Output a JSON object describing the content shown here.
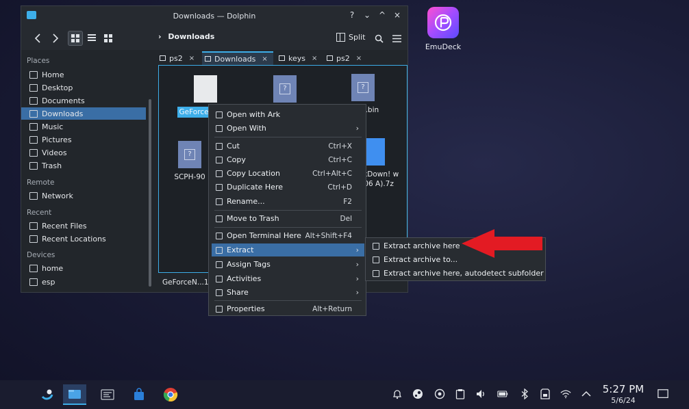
{
  "window": {
    "title": "Downloads — Dolphin",
    "controls": {
      "help": "?",
      "shade": "⌄",
      "maximize": "^",
      "close": "×"
    }
  },
  "toolbar": {
    "breadcrumb_arrow": "›",
    "breadcrumb": "Downloads",
    "split_label": "Split"
  },
  "sidebar": {
    "places_header": "Places",
    "places": [
      "Home",
      "Desktop",
      "Documents",
      "Downloads",
      "Music",
      "Pictures",
      "Videos",
      "Trash"
    ],
    "remote_header": "Remote",
    "remote": [
      "Network"
    ],
    "recent_header": "Recent",
    "recent": [
      "Recent Files",
      "Recent Locations"
    ],
    "devices_header": "Devices",
    "devices": [
      "home",
      "esp"
    ]
  },
  "tabs": [
    {
      "label": "ps2",
      "close": "×"
    },
    {
      "label": "Downloads",
      "close": "×"
    },
    {
      "label": "keys",
      "close": "×"
    },
    {
      "label": "ps2",
      "close": "×"
    }
  ],
  "files": [
    {
      "name": "GeForce Setup"
    },
    {
      "name": ""
    },
    {
      "name": "7008.bin"
    },
    {
      "name": "SCPH-90"
    },
    {
      "name": "ackDown! w 2006 A).7z"
    }
  ],
  "status": {
    "text": "GeForceN...1."
  },
  "context_menu": {
    "items": [
      {
        "label": "Open with Ark",
        "shortcut": "",
        "arrow": ""
      },
      {
        "label": "Open With",
        "shortcut": "",
        "arrow": "›"
      },
      {
        "label": "Cut",
        "shortcut": "Ctrl+X",
        "arrow": ""
      },
      {
        "label": "Copy",
        "shortcut": "Ctrl+C",
        "arrow": ""
      },
      {
        "label": "Copy Location",
        "shortcut": "Ctrl+Alt+C",
        "arrow": ""
      },
      {
        "label": "Duplicate Here",
        "shortcut": "Ctrl+D",
        "arrow": ""
      },
      {
        "label": "Rename...",
        "shortcut": "F2",
        "arrow": ""
      },
      {
        "label": "Move to Trash",
        "shortcut": "Del",
        "arrow": ""
      },
      {
        "label": "Open Terminal Here",
        "shortcut": "Alt+Shift+F4",
        "arrow": ""
      },
      {
        "label": "Extract",
        "shortcut": "",
        "arrow": "›"
      },
      {
        "label": "Assign Tags",
        "shortcut": "",
        "arrow": "›"
      },
      {
        "label": "Activities",
        "shortcut": "",
        "arrow": "›"
      },
      {
        "label": "Share",
        "shortcut": "",
        "arrow": "›"
      },
      {
        "label": "Properties",
        "shortcut": "Alt+Return",
        "arrow": ""
      }
    ]
  },
  "submenu": {
    "items": [
      {
        "label": "Extract archive here"
      },
      {
        "label": "Extract archive to..."
      },
      {
        "label": "Extract archive here, autodetect subfolder"
      }
    ]
  },
  "desktop": {
    "app_label": "EmuDeck"
  },
  "taskbar": {
    "time": "5:27 PM",
    "date": "5/6/24"
  },
  "colors": {
    "accent": "#3daee9",
    "highlight": "#3a6ea5",
    "arrow": "#e31b23"
  }
}
